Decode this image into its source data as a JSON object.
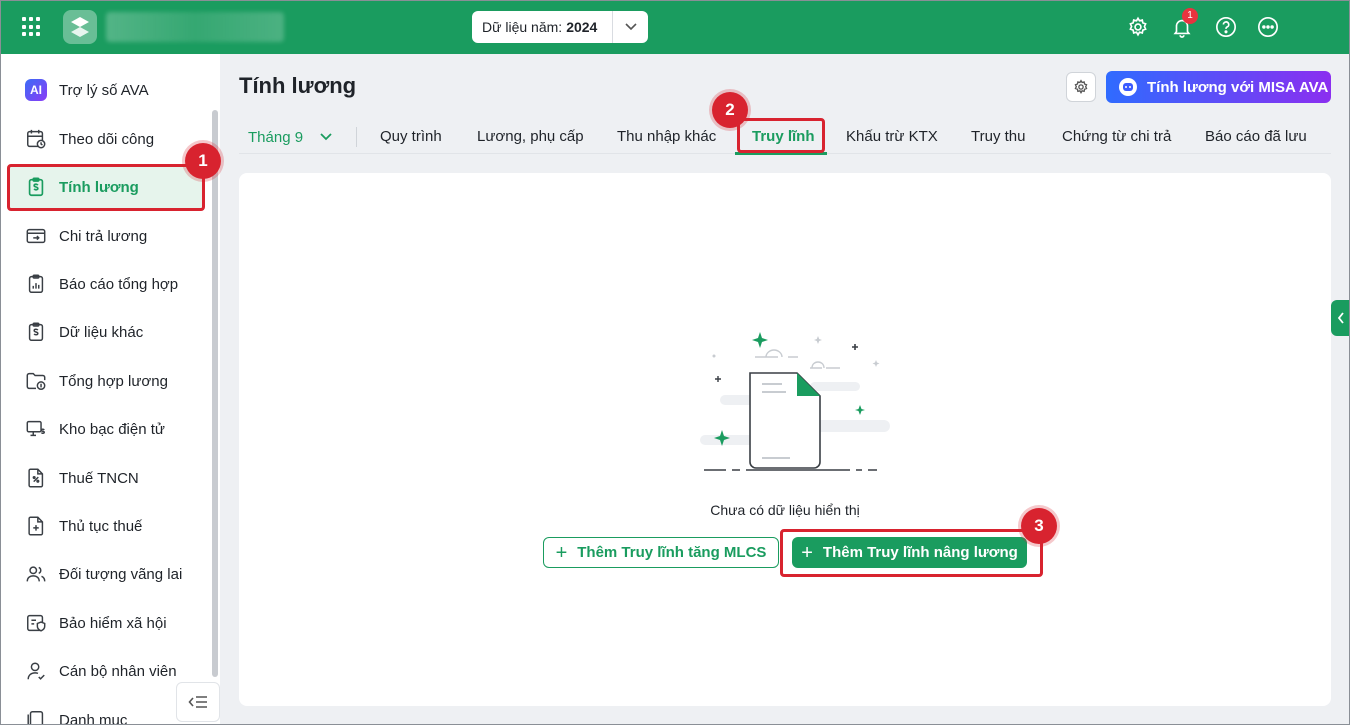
{
  "topbar": {
    "year_label": "Dữ liệu năm:",
    "year_value": "2024",
    "notification_count": "1",
    "icons": [
      "apps-grid-icon",
      "settings-gear-icon",
      "bell-icon",
      "help-icon",
      "more-icon"
    ]
  },
  "sidebar": {
    "items": [
      {
        "label": "Trợ lý số AVA",
        "icon": "ai-assistant-icon"
      },
      {
        "label": "Theo dõi công",
        "icon": "calendar-clock-icon"
      },
      {
        "label": "Tính lương",
        "icon": "payroll-clipboard-icon",
        "active": true
      },
      {
        "label": "Chi trả lương",
        "icon": "wallet-transfer-icon"
      },
      {
        "label": "Báo cáo tổng hợp",
        "icon": "report-chart-icon"
      },
      {
        "label": "Dữ liệu khác",
        "icon": "data-clipboard-icon"
      },
      {
        "label": "Tổng hợp lương",
        "icon": "folder-money-icon"
      },
      {
        "label": "Kho bạc điện tử",
        "icon": "treasury-monitor-icon"
      },
      {
        "label": "Thuế TNCN",
        "icon": "tax-document-icon"
      },
      {
        "label": "Thủ tục thuế",
        "icon": "tax-procedure-icon"
      },
      {
        "label": "Đối tượng vãng lai",
        "icon": "people-icon"
      },
      {
        "label": "Bảo hiểm xã hội",
        "icon": "insurance-shield-icon"
      },
      {
        "label": "Cán bộ nhân viên",
        "icon": "employee-icon"
      },
      {
        "label": "Danh mục",
        "icon": "catalog-icon"
      }
    ]
  },
  "main": {
    "title": "Tính lương",
    "ava_button": "Tính lương với MISA AVA",
    "month": "Tháng 9",
    "tabs": [
      {
        "label": "Quy trình"
      },
      {
        "label": "Lương, phụ cấp"
      },
      {
        "label": "Thu nhập khác"
      },
      {
        "label": "Truy lĩnh",
        "active": true
      },
      {
        "label": "Khấu trừ KTX"
      },
      {
        "label": "Truy thu"
      },
      {
        "label": "Chứng từ chi trả"
      },
      {
        "label": "Báo cáo đã lưu"
      }
    ],
    "empty_text": "Chưa có dữ liệu hiển thị",
    "btn_add_mlcs": "Thêm Truy lĩnh tăng MLCS",
    "btn_add_raise": "Thêm Truy lĩnh nâng lương"
  },
  "annotations": {
    "step1": "1",
    "step2": "2",
    "step3": "3"
  },
  "colors": {
    "brand": "#1a9c5f",
    "highlight": "#d8232f",
    "ava_gradient_start": "#2f6bff",
    "ava_gradient_end": "#8b2ff0"
  }
}
